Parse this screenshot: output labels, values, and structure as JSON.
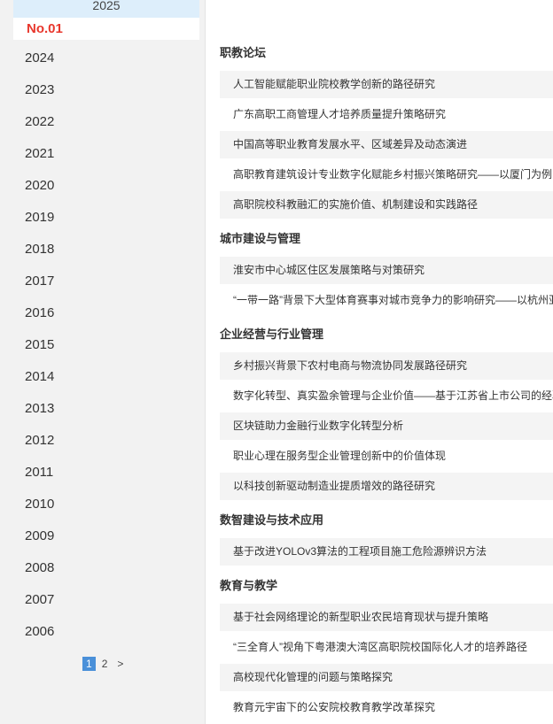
{
  "sidebar": {
    "current_year": "2025",
    "active_issue": "No.01",
    "years": [
      "2024",
      "2023",
      "2022",
      "2021",
      "2020",
      "2019",
      "2018",
      "2017",
      "2016",
      "2015",
      "2014",
      "2013",
      "2012",
      "2011",
      "2010",
      "2009",
      "2008",
      "2007",
      "2006"
    ],
    "pagination": {
      "page1": "1",
      "page2": "2",
      "next": ">"
    }
  },
  "sections": [
    {
      "title": "职教论坛",
      "articles": [
        "人工智能赋能职业院校教学创新的路径研究",
        "广东高职工商管理人才培养质量提升策略研究",
        "中国高等职业教育发展水平、区域差异及动态演进",
        "高职教育建筑设计专业数字化赋能乡村振兴策略研究——以厦门为例",
        "高职院校科教融汇的实施价值、机制建设和实践路径"
      ]
    },
    {
      "title": "城市建设与管理",
      "articles": [
        "淮安市中心城区住区发展策略与对策研究",
        "“一带一路”背景下大型体育赛事对城市竞争力的影响研究——以杭州亚运会为例"
      ]
    },
    {
      "title": "企业经营与行业管理",
      "articles": [
        "乡村振兴背景下农村电商与物流协同发展路径研究",
        "数字化转型、真实盈余管理与企业价值——基于江苏省上市公司的经验证据",
        "区块链助力金融行业数字化转型分析",
        "职业心理在服务型企业管理创新中的价值体现",
        "以科技创新驱动制造业提质增效的路径研究"
      ]
    },
    {
      "title": "数智建设与技术应用",
      "articles": [
        "基于改进YOLOv3算法的工程项目施工危险源辨识方法"
      ]
    },
    {
      "title": "教育与教学",
      "articles": [
        "基于社会网络理论的新型职业农民培育现状与提升策略",
        "“三全育人”视角下粤港澳大湾区高职院校国际化人才的培养路径",
        "高校现代化管理的问题与策略探究",
        "教育元宇宙下的公安院校教育教学改革探究"
      ]
    }
  ]
}
